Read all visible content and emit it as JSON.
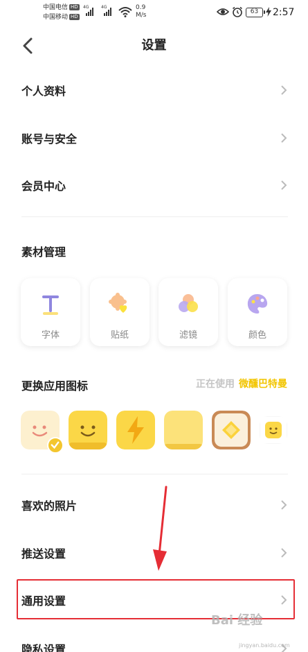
{
  "status_bar": {
    "carrier1": "中国电信",
    "carrier2": "中国移动",
    "hd": "HD",
    "network": "4G",
    "speed_value": "0.9",
    "speed_unit": "M/s",
    "battery": "63",
    "time": "2:57"
  },
  "nav": {
    "title": "设置"
  },
  "profile_rows": [
    {
      "label": "个人资料"
    },
    {
      "label": "账号与安全"
    },
    {
      "label": "会员中心"
    }
  ],
  "materials": {
    "title": "素材管理",
    "items": [
      {
        "label": "字体",
        "icon": "font-icon"
      },
      {
        "label": "贴纸",
        "icon": "sticker-icon"
      },
      {
        "label": "滤镜",
        "icon": "filter-icon"
      },
      {
        "label": "颜色",
        "icon": "palette-icon"
      }
    ]
  },
  "app_icon": {
    "title": "更换应用图标",
    "using_label": "正在使用",
    "current_name": "微醺巴特曼"
  },
  "other_rows": [
    {
      "label": "喜欢的照片"
    },
    {
      "label": "推送设置"
    },
    {
      "label": "通用设置"
    },
    {
      "label": "隐私设置"
    }
  ],
  "watermark": {
    "text": "Bai 经验",
    "sub": "jingyan.baidu.com"
  },
  "colors": {
    "accent_yellow": "#f2c500",
    "highlight_red": "#e52d35"
  }
}
